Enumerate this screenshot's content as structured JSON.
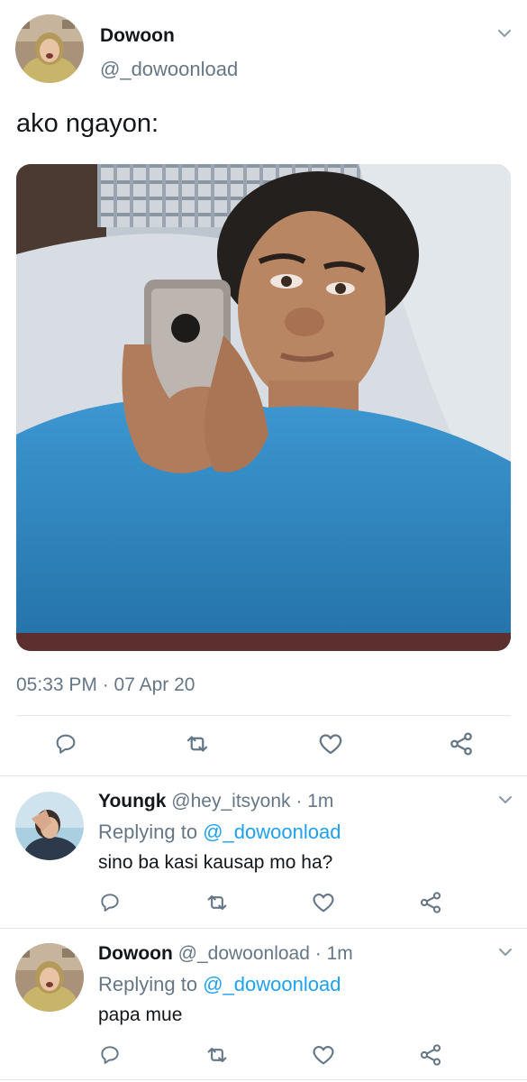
{
  "main_tweet": {
    "author_name": "Dowoon",
    "handle": "@_dowoonload",
    "text": "ako ngayon:",
    "timestamp": "05:33 PM · 07 Apr 20",
    "media_description": "photo"
  },
  "replies": [
    {
      "author_name": "Youngk",
      "handle": "@hey_itsyonk",
      "separator": "·",
      "time": "1m",
      "replying_prefix": "Replying to",
      "replying_to": "@_dowoonload",
      "text": "sino ba kasi kausap mo ha?"
    },
    {
      "author_name": "Dowoon",
      "handle": "@_dowoonload",
      "separator": "·",
      "time": "1m",
      "replying_prefix": "Replying to",
      "replying_to": "@_dowoonload",
      "text": "papa mue"
    }
  ],
  "icons": [
    "chevron-down-icon",
    "reply-icon",
    "retweet-icon",
    "like-icon",
    "share-icon"
  ],
  "colors": {
    "link": "#1da1f2",
    "secondary": "#657786",
    "divider": "#e1e8ed",
    "icon": "#657786"
  }
}
